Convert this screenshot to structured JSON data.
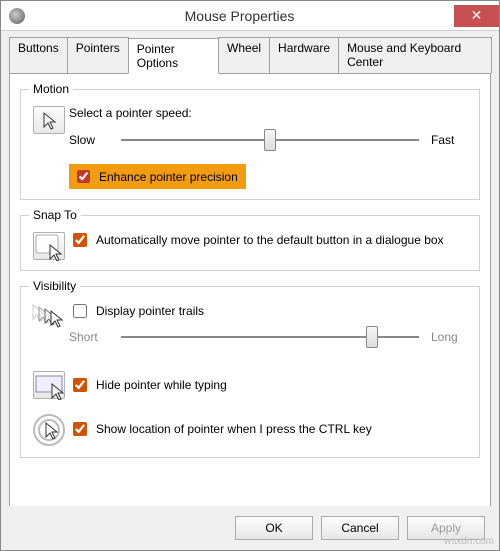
{
  "window": {
    "title": "Mouse Properties",
    "close_glyph": "✕"
  },
  "tabs": {
    "items": [
      "Buttons",
      "Pointers",
      "Pointer Options",
      "Wheel",
      "Hardware",
      "Mouse and Keyboard Center"
    ],
    "selected_index": 2
  },
  "motion": {
    "legend": "Motion",
    "speed_label": "Select a pointer speed:",
    "slow": "Slow",
    "fast": "Fast",
    "speed_value": 6,
    "speed_min": 1,
    "speed_max": 11,
    "enhance_label": "Enhance pointer precision",
    "enhance_checked": true
  },
  "snapto": {
    "legend": "Snap To",
    "auto_label": "Automatically move pointer to the default button in a dialogue box",
    "auto_checked": true
  },
  "visibility": {
    "legend": "Visibility",
    "trails_label": "Display pointer trails",
    "trails_checked": false,
    "trails_short": "Short",
    "trails_long": "Long",
    "trails_value": 7,
    "trails_min": 1,
    "trails_max": 8,
    "hide_label": "Hide pointer while typing",
    "hide_checked": true,
    "ctrl_label": "Show location of pointer when I press the CTRL key",
    "ctrl_checked": true
  },
  "buttons": {
    "ok": "OK",
    "cancel": "Cancel",
    "apply": "Apply"
  },
  "watermark": "wsxdn.com"
}
